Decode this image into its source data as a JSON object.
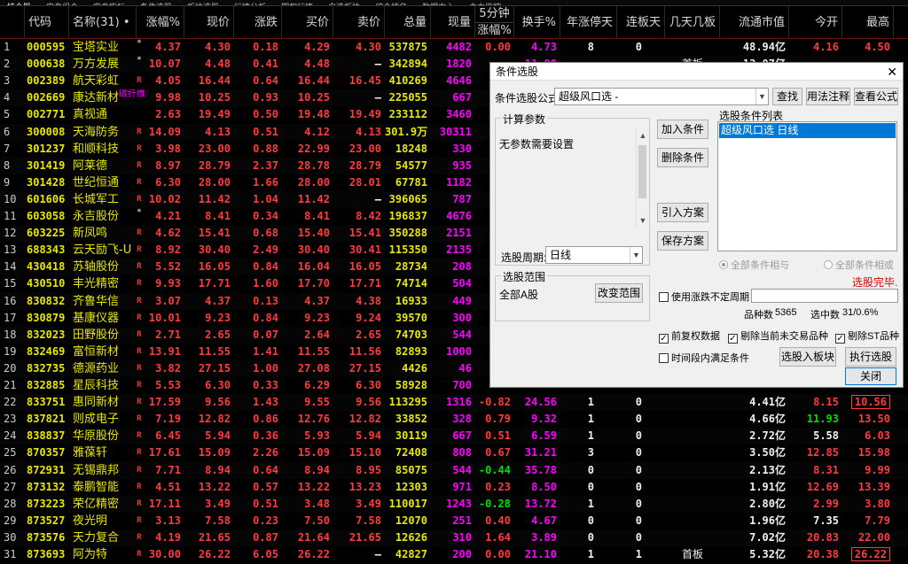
{
  "topbar": [
    "持仓股",
    "实盘组合",
    "实盘指标",
    "条件选股",
    "板块选股",
    "行情分析",
    "期权行情",
    "自选板块",
    "综合排名",
    "数据中心",
    "主力监控"
  ],
  "header": {
    "idx": "",
    "code": "代码",
    "name": "名称(31)",
    "name_dot": "•",
    "pct": "涨幅%",
    "price": "现价",
    "chg": "涨跌",
    "bid": "买价",
    "ask": "卖价",
    "vol": "总量",
    "cur": "现量",
    "min5_top": "5分钟",
    "min5_bot": "涨幅%",
    "turn": "换手%",
    "ylimit": "年涨停天",
    "lb": "连板天",
    "jt": "几天几板",
    "mcap": "流通市值",
    "open": "今开",
    "high": "最高"
  },
  "rows": [
    {
      "i": "1",
      "code": "000595",
      "name": "宝塔实业",
      "flag": "*",
      "tag": "",
      "pct": "4.37",
      "price": "4.30",
      "chg": "0.18",
      "bid": "4.29",
      "ask": "4.30",
      "vol": "537875",
      "cur": "4482",
      "m5": "0.00",
      "turn": "4.73",
      "yl": "8",
      "lb": "0",
      "jt": "",
      "mcap": "48.94亿",
      "open": "4.16",
      "high": "4.50"
    },
    {
      "i": "2",
      "code": "000638",
      "name": "万方发展",
      "flag": "*",
      "tag": "",
      "pct": "10.07",
      "price": "4.48",
      "chg": "0.41",
      "bid": "4.48",
      "ask": "—",
      "vol": "342894",
      "cur": "1820",
      "m5": "",
      "turn": "",
      "yl": "",
      "lb": "",
      "jt": "",
      "mcap": "",
      "open": "",
      "high": ""
    },
    {
      "i": "3",
      "code": "002389",
      "name": "航天彩虹",
      "flag": "R",
      "tag": "",
      "pct": "4.05",
      "price": "16.44",
      "chg": "0.64",
      "bid": "16.44",
      "ask": "16.45",
      "vol": "410269",
      "cur": "4646",
      "m5": "",
      "turn": "",
      "yl": "",
      "lb": "",
      "jt": "",
      "mcap": "",
      "open": "",
      "high": ""
    },
    {
      "i": "4",
      "code": "002669",
      "name": "康达新材",
      "flag": "",
      "tag": "碳纤维",
      "pct": "9.98",
      "price": "10.25",
      "chg": "0.93",
      "bid": "10.25",
      "ask": "—",
      "vol": "225055",
      "cur": "667",
      "m5": "",
      "turn": "",
      "yl": "",
      "lb": "",
      "jt": "",
      "mcap": "",
      "open": "",
      "high": ""
    },
    {
      "i": "5",
      "code": "002771",
      "name": "真视通",
      "flag": "",
      "tag": "",
      "pct": "2.63",
      "price": "19.49",
      "chg": "0.50",
      "bid": "19.48",
      "ask": "19.49",
      "vol": "233112",
      "cur": "3460",
      "m5": "",
      "turn": "",
      "yl": "",
      "lb": "",
      "jt": "",
      "mcap": "",
      "open": "",
      "high": ""
    },
    {
      "i": "6",
      "code": "300008",
      "name": "天海防务",
      "flag": "R",
      "tag": "",
      "pct": "14.09",
      "price": "4.13",
      "chg": "0.51",
      "bid": "4.12",
      "ask": "4.13",
      "vol": "301.9万",
      "cur": "30311",
      "m5": "",
      "turn": "",
      "yl": "",
      "lb": "",
      "jt": "",
      "mcap": "",
      "open": "",
      "high": ""
    },
    {
      "i": "7",
      "code": "301237",
      "name": "和顺科技",
      "flag": "R",
      "tag": "",
      "pct": "3.98",
      "price": "23.00",
      "chg": "0.88",
      "bid": "22.99",
      "ask": "23.00",
      "vol": "18248",
      "cur": "330",
      "m5": "",
      "turn": "",
      "yl": "",
      "lb": "",
      "jt": "",
      "mcap": "",
      "open": "",
      "high": ""
    },
    {
      "i": "8",
      "code": "301419",
      "name": "阿莱德",
      "flag": "R",
      "tag": "",
      "pct": "8.97",
      "price": "28.79",
      "chg": "2.37",
      "bid": "28.78",
      "ask": "28.79",
      "vol": "54577",
      "cur": "935",
      "m5": "",
      "turn": "",
      "yl": "",
      "lb": "",
      "jt": "",
      "mcap": "",
      "open": "",
      "high": ""
    },
    {
      "i": "9",
      "code": "301428",
      "name": "世纪恒通",
      "flag": "R",
      "tag": "",
      "pct": "6.30",
      "price": "28.00",
      "chg": "1.66",
      "bid": "28.00",
      "ask": "28.01",
      "vol": "67781",
      "cur": "1182",
      "m5": "",
      "turn": "",
      "yl": "",
      "lb": "",
      "jt": "",
      "mcap": "",
      "open": "",
      "high": ""
    },
    {
      "i": "10",
      "code": "601606",
      "name": "长城军工",
      "flag": "R",
      "tag": "",
      "pct": "10.02",
      "price": "11.42",
      "chg": "1.04",
      "bid": "11.42",
      "ask": "—",
      "vol": "396065",
      "cur": "787",
      "m5": "",
      "turn": "",
      "yl": "",
      "lb": "",
      "jt": "",
      "mcap": "",
      "open": "",
      "high": ""
    },
    {
      "i": "11",
      "code": "603058",
      "name": "永吉股份",
      "flag": "*",
      "tag": "",
      "pct": "4.21",
      "price": "8.41",
      "chg": "0.34",
      "bid": "8.41",
      "ask": "8.42",
      "vol": "196837",
      "cur": "4676",
      "m5": "",
      "turn": "",
      "yl": "",
      "lb": "",
      "jt": "",
      "mcap": "",
      "open": "",
      "high": ""
    },
    {
      "i": "12",
      "code": "603225",
      "name": "新凤鸣",
      "flag": "R",
      "tag": "",
      "pct": "4.62",
      "price": "15.41",
      "chg": "0.68",
      "bid": "15.40",
      "ask": "15.41",
      "vol": "350288",
      "cur": "2151",
      "m5": "",
      "turn": "",
      "yl": "",
      "lb": "",
      "jt": "",
      "mcap": "",
      "open": "",
      "high": ""
    },
    {
      "i": "13",
      "code": "688343",
      "name": "云天励飞-U",
      "flag": "R",
      "tag": "",
      "pct": "8.92",
      "price": "30.40",
      "chg": "2.49",
      "bid": "30.40",
      "ask": "30.41",
      "vol": "115350",
      "cur": "2135",
      "m5": "",
      "turn": "",
      "yl": "",
      "lb": "",
      "jt": "",
      "mcap": "",
      "open": "",
      "high": ""
    },
    {
      "i": "14",
      "code": "430418",
      "name": "苏轴股份",
      "flag": "R",
      "tag": "",
      "pct": "5.52",
      "price": "16.05",
      "chg": "0.84",
      "bid": "16.04",
      "ask": "16.05",
      "vol": "28734",
      "cur": "208",
      "m5": "",
      "turn": "",
      "yl": "",
      "lb": "",
      "jt": "",
      "mcap": "",
      "open": "",
      "high": ""
    },
    {
      "i": "15",
      "code": "430510",
      "name": "丰光精密",
      "flag": "R",
      "tag": "",
      "pct": "9.93",
      "price": "17.71",
      "chg": "1.60",
      "bid": "17.70",
      "ask": "17.71",
      "vol": "74714",
      "cur": "504",
      "m5": "",
      "turn": "",
      "yl": "",
      "lb": "",
      "jt": "",
      "mcap": "",
      "open": "",
      "high": ""
    },
    {
      "i": "16",
      "code": "830832",
      "name": "齐鲁华信",
      "flag": "R",
      "tag": "",
      "pct": "3.07",
      "price": "4.37",
      "chg": "0.13",
      "bid": "4.37",
      "ask": "4.38",
      "vol": "16933",
      "cur": "449",
      "m5": "",
      "turn": "",
      "yl": "",
      "lb": "",
      "jt": "",
      "mcap": "",
      "open": "",
      "high": ""
    },
    {
      "i": "17",
      "code": "830879",
      "name": "基康仪器",
      "flag": "R",
      "tag": "",
      "pct": "10.01",
      "price": "9.23",
      "chg": "0.84",
      "bid": "9.23",
      "ask": "9.24",
      "vol": "39570",
      "cur": "300",
      "m5": "",
      "turn": "",
      "yl": "",
      "lb": "",
      "jt": "",
      "mcap": "",
      "open": "",
      "high": ""
    },
    {
      "i": "18",
      "code": "832023",
      "name": "田野股份",
      "flag": "R",
      "tag": "",
      "pct": "2.71",
      "price": "2.65",
      "chg": "0.07",
      "bid": "2.64",
      "ask": "2.65",
      "vol": "74703",
      "cur": "544",
      "m5": "",
      "turn": "",
      "yl": "",
      "lb": "",
      "jt": "",
      "mcap": "",
      "open": "",
      "high": ""
    },
    {
      "i": "19",
      "code": "832469",
      "name": "富恒新材",
      "flag": "R",
      "tag": "",
      "pct": "13.91",
      "price": "11.55",
      "chg": "1.41",
      "bid": "11.55",
      "ask": "11.56",
      "vol": "82893",
      "cur": "1000",
      "m5": "",
      "turn": "",
      "yl": "",
      "lb": "",
      "jt": "",
      "mcap": "",
      "open": "",
      "high": ""
    },
    {
      "i": "20",
      "code": "832735",
      "name": "德源药业",
      "flag": "R",
      "tag": "",
      "pct": "3.82",
      "price": "27.15",
      "chg": "1.00",
      "bid": "27.08",
      "ask": "27.15",
      "vol": "4426",
      "cur": "46",
      "m5": "",
      "turn": "",
      "yl": "",
      "lb": "",
      "jt": "",
      "mcap": "",
      "open": "",
      "high": ""
    },
    {
      "i": "21",
      "code": "832885",
      "name": "星辰科技",
      "flag": "R",
      "tag": "",
      "pct": "5.53",
      "price": "6.30",
      "chg": "0.33",
      "bid": "6.29",
      "ask": "6.30",
      "vol": "58928",
      "cur": "700",
      "m5": "",
      "turn": "",
      "yl": "",
      "lb": "",
      "jt": "",
      "mcap": "",
      "open": "",
      "high": ""
    },
    {
      "i": "22",
      "code": "833751",
      "name": "惠同新材",
      "flag": "R",
      "tag": "",
      "pct": "17.59",
      "price": "9.56",
      "chg": "1.43",
      "bid": "9.55",
      "ask": "9.56",
      "vol": "113295",
      "cur": "1316",
      "m5": "-0.82",
      "turn": "24.56",
      "yl": "1",
      "lb": "0",
      "jt": "",
      "mcap": "4.41亿",
      "open": "8.15",
      "high": "10.56",
      "hibox": true
    },
    {
      "i": "23",
      "code": "837821",
      "name": "则成电子",
      "flag": "R",
      "tag": "",
      "pct": "7.19",
      "price": "12.82",
      "chg": "0.86",
      "bid": "12.76",
      "ask": "12.82",
      "vol": "33852",
      "cur": "328",
      "m5": "0.79",
      "turn": "9.32",
      "yl": "1",
      "lb": "0",
      "jt": "",
      "mcap": "4.66亿",
      "open": "11.93",
      "high": "13.50",
      "open_c": "green"
    },
    {
      "i": "24",
      "code": "838837",
      "name": "华原股份",
      "flag": "R",
      "tag": "",
      "pct": "6.45",
      "price": "5.94",
      "chg": "0.36",
      "bid": "5.93",
      "ask": "5.94",
      "vol": "30119",
      "cur": "667",
      "m5": "0.51",
      "turn": "6.59",
      "yl": "1",
      "lb": "0",
      "jt": "",
      "mcap": "2.72亿",
      "open": "5.58",
      "high": "6.03",
      "open_c": "white"
    },
    {
      "i": "25",
      "code": "870357",
      "name": "雅葆轩",
      "flag": "R",
      "tag": "",
      "pct": "17.61",
      "price": "15.09",
      "chg": "2.26",
      "bid": "15.09",
      "ask": "15.10",
      "vol": "72408",
      "cur": "808",
      "m5": "0.67",
      "turn": "31.21",
      "yl": "3",
      "lb": "0",
      "jt": "",
      "mcap": "3.50亿",
      "open": "12.85",
      "high": "15.98"
    },
    {
      "i": "26",
      "code": "872931",
      "name": "无锡鼎邦",
      "flag": "R",
      "tag": "",
      "pct": "7.71",
      "price": "8.94",
      "chg": "0.64",
      "bid": "8.94",
      "ask": "8.95",
      "vol": "85075",
      "cur": "544",
      "m5": "-0.44",
      "turn": "35.78",
      "yl": "0",
      "lb": "0",
      "jt": "",
      "mcap": "2.13亿",
      "open": "8.31",
      "high": "9.99",
      "m5_c": "green"
    },
    {
      "i": "27",
      "code": "873132",
      "name": "泰鹏智能",
      "flag": "R",
      "tag": "",
      "pct": "4.51",
      "price": "13.22",
      "chg": "0.57",
      "bid": "13.22",
      "ask": "13.23",
      "vol": "12303",
      "cur": "971",
      "m5": "0.23",
      "turn": "8.50",
      "yl": "0",
      "lb": "0",
      "jt": "",
      "mcap": "1.91亿",
      "open": "12.69",
      "high": "13.39"
    },
    {
      "i": "28",
      "code": "873223",
      "name": "荣亿精密",
      "flag": "R",
      "tag": "",
      "pct": "17.11",
      "price": "3.49",
      "chg": "0.51",
      "bid": "3.48",
      "ask": "3.49",
      "vol": "110017",
      "cur": "1243",
      "m5": "-0.28",
      "turn": "13.72",
      "yl": "1",
      "lb": "0",
      "jt": "",
      "mcap": "2.80亿",
      "open": "2.99",
      "high": "3.80",
      "m5_c": "green"
    },
    {
      "i": "29",
      "code": "873527",
      "name": "夜光明",
      "flag": "R",
      "tag": "",
      "pct": "3.13",
      "price": "7.58",
      "chg": "0.23",
      "bid": "7.50",
      "ask": "7.58",
      "vol": "12070",
      "cur": "251",
      "m5": "0.40",
      "turn": "4.67",
      "yl": "0",
      "lb": "0",
      "jt": "",
      "mcap": "1.96亿",
      "open": "7.35",
      "high": "7.79",
      "open_c": "white"
    },
    {
      "i": "30",
      "code": "873576",
      "name": "天力复合",
      "flag": "R",
      "tag": "",
      "pct": "4.19",
      "price": "21.65",
      "chg": "0.87",
      "bid": "21.64",
      "ask": "21.65",
      "vol": "12626",
      "cur": "310",
      "m5": "1.64",
      "turn": "3.89",
      "yl": "0",
      "lb": "0",
      "jt": "",
      "mcap": "7.02亿",
      "open": "20.83",
      "high": "22.00"
    },
    {
      "i": "31",
      "code": "873693",
      "name": "阿为特",
      "flag": "R",
      "tag": "",
      "pct": "30.00",
      "price": "26.22",
      "chg": "6.05",
      "bid": "26.22",
      "ask": "—",
      "vol": "42827",
      "cur": "200",
      "m5": "0.00",
      "turn": "21.10",
      "yl": "1",
      "lb": "1",
      "jt": "首板",
      "mcap": "5.32亿",
      "open": "20.38",
      "high": "26.22",
      "hibox": true
    }
  ],
  "extra_row2": {
    "turn": "11.00",
    "yl": "",
    "jt": "首板",
    "mcap": "13.07亿"
  },
  "dialog": {
    "title": "条件选股",
    "formula_label": "条件选股公式",
    "formula_value": "超级风口选  -",
    "find_btn": "查找",
    "usage_btn": "用法注释",
    "view_btn": "查看公式",
    "params_group": "计算参数",
    "params_text": "无参数需要设置",
    "add_btn": "加入条件",
    "del_btn": "删除条件",
    "import_btn": "引入方案",
    "save_btn": "保存方案",
    "list_title": "选股条件列表",
    "list_items": [
      "超级风口选  日线"
    ],
    "period_label": "选股周期:",
    "period_value": "日线",
    "radio_and": "全部条件相与",
    "radio_or": "全部条件相或",
    "status": "选股完毕.",
    "range_group": "选股范围",
    "range_value": "全部A股",
    "change_range_btn": "改变范围",
    "chk_indef": "使用涨跌不定周期",
    "count_label": "品种数",
    "count_value": "5365",
    "selected_label": "选中数",
    "selected_value": "31/0.6%",
    "chk_adj": "前复权数据",
    "chk_untraded": "剔除当前未交易品种",
    "chk_st": "剔除ST品种",
    "chk_period": "时间段内满足条件",
    "to_block_btn": "选股入板块",
    "run_btn": "执行选股",
    "close_btn": "关闭",
    "close_x": "✕"
  }
}
